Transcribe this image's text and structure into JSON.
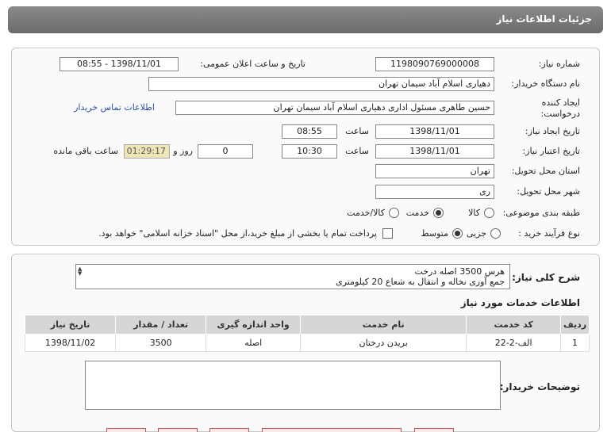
{
  "header": {
    "title": "جزئیات اطلاعات نیاز"
  },
  "form": {
    "need_number_label": "شماره نیاز:",
    "need_number": "1198090769000008",
    "announce_label": "تاریخ و ساعت اعلان عمومی:",
    "announce_value": "1398/11/01 - 08:55",
    "buyer_org_label": "نام دستگاه خریدار:",
    "buyer_org": "دهیاری اسلام آباد سیمان تهران",
    "creator_label_1": "ایجاد کننده",
    "creator_label_2": "درخواست:",
    "creator": "حسین طاهری مسئول اداری دهیاری اسلام آباد سیمان تهران",
    "contact_link": "اطلاعات تماس خریدار",
    "create_date_label": "تاریخ ایجاد نیاز:",
    "create_date": "1398/11/01",
    "hour_label": "ساعت",
    "create_time": "08:55",
    "validity_label": "تاریخ اعتبار نیاز:",
    "validity_date": "1398/11/01",
    "validity_time": "10:30",
    "day_and_label": "روز و",
    "days": "0",
    "remaining_time": "01:29:17",
    "remaining_label": "ساعت باقی مانده",
    "province_label": "استان محل تحویل:",
    "province": "تهران",
    "city_label": "شهر محل تحویل:",
    "city": "ری",
    "category_label": "طبقه بندی موضوعی:",
    "category_options": [
      "کالا",
      "خدمت",
      "کالا/خدمت"
    ],
    "category_selected": "خدمت",
    "process_label": "نوع فرآیند خرید :",
    "process_options": [
      "جزیی",
      "متوسط"
    ],
    "process_selected": "متوسط",
    "payment_note": "پرداخت تمام یا بخشی از مبلغ خرید،از محل \"اسناد خزانه اسلامی\" خواهد بود."
  },
  "description": {
    "label": "شرح کلی نیاز:",
    "line1": "هرس 3500 اصله درخت",
    "line2": "جمع آوری نخاله و انتقال به شعاع 20 کیلومتری"
  },
  "services": {
    "section_title": "اطلاعات خدمات مورد نیاز",
    "columns": [
      "ردیف",
      "کد خدمت",
      "نام خدمت",
      "واحد اندازه گیری",
      "تعداد / مقدار",
      "تاریخ نیاز"
    ],
    "rows": [
      [
        "1",
        "الف-2-22",
        "بریدن درختان",
        "اصله",
        "3500",
        "1398/11/02"
      ]
    ]
  },
  "buyer_notes": {
    "label": "توضیحات خریدار:",
    "value": ""
  },
  "colors": {
    "header_bg": "#6b6b6b",
    "link": "#2a4ea8",
    "remaining_bg": "#efe6b8"
  }
}
